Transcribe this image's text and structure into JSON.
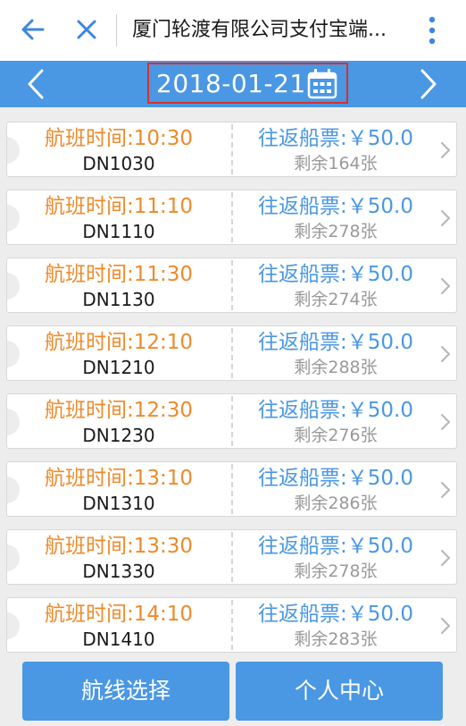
{
  "header": {
    "title": "厦门轮渡有限公司支付宝端...",
    "back_icon": "arrow-left-icon",
    "close_icon": "close-icon",
    "more_icon": "vertical-dots-icon",
    "accent": "#3d86e0"
  },
  "datebar": {
    "date": "2018-01-21",
    "prev_icon": "chevron-left-icon",
    "next_icon": "chevron-right-icon",
    "calendar_icon": "calendar-icon",
    "background": "#4a97e4",
    "highlight_border": "#d9302a"
  },
  "flights": [
    {
      "time": "航班时间:10:30",
      "code": "DN1030",
      "price": "往返船票:￥50.0",
      "remaining": "剩余164张"
    },
    {
      "time": "航班时间:11:10",
      "code": "DN1110",
      "price": "往返船票:￥50.0",
      "remaining": "剩余278张"
    },
    {
      "time": "航班时间:11:30",
      "code": "DN1130",
      "price": "往返船票:￥50.0",
      "remaining": "剩余274张"
    },
    {
      "time": "航班时间:12:10",
      "code": "DN1210",
      "price": "往返船票:￥50.0",
      "remaining": "剩余288张"
    },
    {
      "time": "航班时间:12:30",
      "code": "DN1230",
      "price": "往返船票:￥50.0",
      "remaining": "剩余276张"
    },
    {
      "time": "航班时间:13:10",
      "code": "DN1310",
      "price": "往返船票:￥50.0",
      "remaining": "剩余286张"
    },
    {
      "time": "航班时间:13:30",
      "code": "DN1330",
      "price": "往返船票:￥50.0",
      "remaining": "剩余278张"
    },
    {
      "time": "航班时间:14:10",
      "code": "DN1410",
      "price": "往返船票:￥50.0",
      "remaining": "剩余283张"
    }
  ],
  "colors": {
    "time": "#ef8a2a",
    "price": "#4a97e4",
    "remaining": "#999999"
  },
  "bottom": {
    "route_label": "航线选择",
    "profile_label": "个人中心"
  }
}
